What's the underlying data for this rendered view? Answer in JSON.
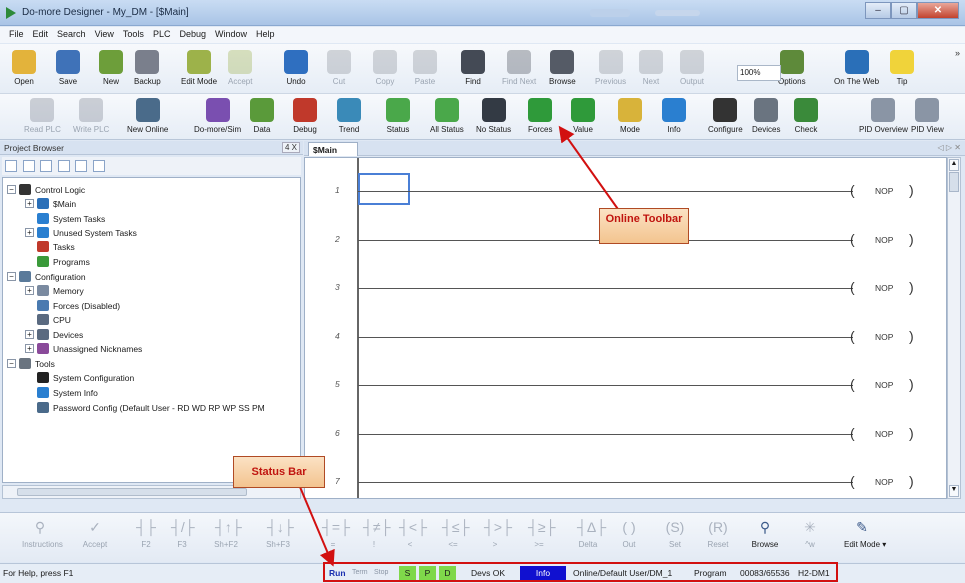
{
  "window": {
    "title": "Do-more Designer - My_DM - [$Main]",
    "buttons": [
      "–",
      "▢",
      "✕"
    ]
  },
  "menu": [
    "File",
    "Edit",
    "Search",
    "View",
    "Tools",
    "PLC",
    "Debug",
    "Window",
    "Help"
  ],
  "toolbar1": [
    {
      "label": "Open",
      "icon": "folder-open-icon",
      "color": "#e3b33b",
      "enabled": true
    },
    {
      "label": "Save",
      "icon": "save-icon",
      "color": "#3f72b8",
      "enabled": true
    },
    {
      "label": "New",
      "icon": "new-icon",
      "color": "#6d9e3a",
      "enabled": true
    },
    {
      "label": "Backup",
      "icon": "backup-icon",
      "color": "#7a7f8c",
      "enabled": true
    },
    {
      "label": "Edit Mode",
      "icon": "edit-mode-icon",
      "color": "#9db24a",
      "enabled": true
    },
    {
      "label": "Accept",
      "icon": "accept-icon",
      "color": "#9ab04a",
      "enabled": false
    },
    {
      "label": "Undo",
      "icon": "undo-icon",
      "color": "#2f6fc0",
      "enabled": true
    },
    {
      "label": "Cut",
      "icon": "cut-icon",
      "color": "#8a8f99",
      "enabled": false
    },
    {
      "label": "Copy",
      "icon": "copy-icon",
      "color": "#8a8f99",
      "enabled": false
    },
    {
      "label": "Paste",
      "icon": "paste-icon",
      "color": "#8a8f99",
      "enabled": false
    },
    {
      "label": "Find",
      "icon": "binoculars-icon",
      "color": "#444a55",
      "enabled": true
    },
    {
      "label": "Find Next",
      "icon": "find-next-icon",
      "color": "#444a55",
      "enabled": false
    },
    {
      "label": "Browse",
      "icon": "browse-icon",
      "color": "#555b66",
      "enabled": true
    },
    {
      "label": "Previous",
      "icon": "previous-icon",
      "color": "#8a8f99",
      "enabled": false
    },
    {
      "label": "Next",
      "icon": "next-icon",
      "color": "#8a8f99",
      "enabled": false
    },
    {
      "label": "Output",
      "icon": "output-icon",
      "color": "#8a8f99",
      "enabled": false
    },
    {
      "label": "Options",
      "icon": "options-icon",
      "color": "#5e8a3a",
      "enabled": true
    },
    {
      "label": "On The Web",
      "icon": "globe-icon",
      "color": "#2a6fb8",
      "enabled": true
    },
    {
      "label": "Tip",
      "icon": "lightbulb-icon",
      "color": "#f0d33a",
      "enabled": true
    }
  ],
  "zoom_value": "100%",
  "toolbar2": [
    {
      "label": "Read PLC",
      "icon": "read-plc-icon",
      "color": "#7a8290",
      "enabled": false
    },
    {
      "label": "Write PLC",
      "icon": "write-plc-icon",
      "color": "#7a8290",
      "enabled": false
    },
    {
      "label": "New Online",
      "icon": "new-online-icon",
      "color": "#4a6b8a",
      "enabled": true
    },
    {
      "label": "Do-more/Sim",
      "icon": "sim-icon",
      "color": "#7a4fb0",
      "enabled": true
    },
    {
      "label": "Data",
      "icon": "data-icon",
      "color": "#5a9a3a",
      "enabled": true
    },
    {
      "label": "Debug",
      "icon": "debug-icon",
      "color": "#c0392b",
      "enabled": true
    },
    {
      "label": "Trend",
      "icon": "trend-icon",
      "color": "#3a8ab8",
      "enabled": true
    },
    {
      "label": "Status",
      "icon": "status-icon",
      "color": "#4aa84a",
      "enabled": true
    },
    {
      "label": "All Status",
      "icon": "all-status-icon",
      "color": "#4aa84a",
      "enabled": true
    },
    {
      "label": "No Status",
      "icon": "no-status-icon",
      "color": "#333a44",
      "enabled": true
    },
    {
      "label": "Forces",
      "icon": "forces-icon",
      "color": "#2f9a3a",
      "enabled": true
    },
    {
      "label": "Value",
      "icon": "value-icon",
      "color": "#2f9a3a",
      "enabled": true
    },
    {
      "label": "Mode",
      "icon": "mode-icon",
      "color": "#d8b33a",
      "enabled": true
    },
    {
      "label": "Info",
      "icon": "info-icon",
      "color": "#2a7fd0",
      "enabled": true
    },
    {
      "label": "Configure",
      "icon": "configure-icon",
      "color": "#333333",
      "enabled": true
    },
    {
      "label": "Devices",
      "icon": "devices-icon",
      "color": "#6a7480",
      "enabled": true
    },
    {
      "label": "Check",
      "icon": "check-icon",
      "color": "#3a8a3a",
      "enabled": true
    },
    {
      "label": "PID Overview",
      "icon": "pid-overview-icon",
      "color": "#8a95a5",
      "enabled": true
    },
    {
      "label": "PID View",
      "icon": "pid-view-icon",
      "color": "#8a95a5",
      "enabled": true
    }
  ],
  "project_browser": {
    "title": "Project Browser",
    "pin": "4 X",
    "items": [
      {
        "label": "Control Logic",
        "depth": 0,
        "box": "−",
        "icon": "control-logic-icon",
        "color": "#333333"
      },
      {
        "label": "$Main",
        "depth": 1,
        "box": "+",
        "icon": "main-program-icon",
        "color": "#2a6fb8"
      },
      {
        "label": "System Tasks",
        "depth": 1,
        "box": "",
        "icon": "system-tasks-icon",
        "color": "#2a7fd0"
      },
      {
        "label": "Unused System Tasks",
        "depth": 1,
        "box": "+",
        "icon": "unused-tasks-icon",
        "color": "#2a7fd0"
      },
      {
        "label": "Tasks",
        "depth": 1,
        "box": "",
        "icon": "tasks-icon",
        "color": "#c0392b"
      },
      {
        "label": "Programs",
        "depth": 1,
        "box": "",
        "icon": "programs-icon",
        "color": "#3a9a3a"
      },
      {
        "label": "Configuration",
        "depth": 0,
        "box": "−",
        "icon": "configuration-icon",
        "color": "#5a7a9a"
      },
      {
        "label": "Memory",
        "depth": 1,
        "box": "+",
        "icon": "memory-icon",
        "color": "#7a8aa0"
      },
      {
        "label": "Forces (Disabled)",
        "depth": 1,
        "box": "",
        "icon": "forces-disabled-icon",
        "color": "#4a7ab0"
      },
      {
        "label": "CPU",
        "depth": 1,
        "box": "",
        "icon": "cpu-icon",
        "color": "#5a6a80"
      },
      {
        "label": "Devices",
        "depth": 1,
        "box": "+",
        "icon": "devices-tree-icon",
        "color": "#5a6a80"
      },
      {
        "label": "Unassigned Nicknames",
        "depth": 1,
        "box": "+",
        "icon": "nicknames-icon",
        "color": "#8a4a9a"
      },
      {
        "label": "Tools",
        "depth": 0,
        "box": "−",
        "icon": "tools-icon",
        "color": "#6a7480"
      },
      {
        "label": "System Configuration",
        "depth": 1,
        "box": "",
        "icon": "system-config-icon",
        "color": "#222222"
      },
      {
        "label": "System Info",
        "depth": 1,
        "box": "",
        "icon": "system-info-icon",
        "color": "#2a7fd0"
      },
      {
        "label": "Password Config (Default User - RD WD RP WP SS PM",
        "depth": 1,
        "box": "",
        "icon": "password-config-icon",
        "color": "#4a6a8a"
      }
    ]
  },
  "editor": {
    "tab": "$Main",
    "tab_nav": "◁ ▷ ✕",
    "rungs": [
      {
        "num": "1",
        "instruction": "NOP"
      },
      {
        "num": "2",
        "instruction": "NOP"
      },
      {
        "num": "3",
        "instruction": "NOP"
      },
      {
        "num": "4",
        "instruction": "NOP"
      },
      {
        "num": "5",
        "instruction": "NOP"
      },
      {
        "num": "6",
        "instruction": "NOP"
      },
      {
        "num": "7",
        "instruction": "NOP"
      }
    ]
  },
  "instruction_bar": [
    {
      "label": "Instructions",
      "glyph": "⚲",
      "enabled": false
    },
    {
      "label": "Accept",
      "glyph": "✓",
      "enabled": false
    },
    {
      "label": "F2",
      "glyph": "┤├",
      "enabled": false
    },
    {
      "label": "F3",
      "glyph": "┤/├",
      "enabled": false
    },
    {
      "label": "Sh+F2",
      "glyph": "┤↑├",
      "enabled": false
    },
    {
      "label": "Sh+F3",
      "glyph": "┤↓├",
      "enabled": false
    },
    {
      "label": "=",
      "glyph": "┤=├",
      "enabled": false
    },
    {
      "label": "!",
      "glyph": "┤≠├",
      "enabled": false
    },
    {
      "label": "<",
      "glyph": "┤<├",
      "enabled": false
    },
    {
      "label": "<=",
      "glyph": "┤≤├",
      "enabled": false
    },
    {
      "label": ">",
      "glyph": "┤>├",
      "enabled": false
    },
    {
      "label": ">=",
      "glyph": "┤≥├",
      "enabled": false
    },
    {
      "label": "Delta",
      "glyph": "┤Δ├",
      "enabled": false
    },
    {
      "label": "Out",
      "glyph": "( )",
      "enabled": false
    },
    {
      "label": "Set",
      "glyph": "(S)",
      "enabled": false
    },
    {
      "label": "Reset",
      "glyph": "(R)",
      "enabled": false
    },
    {
      "label": "Browse",
      "glyph": "⚲",
      "enabled": true
    },
    {
      "label": "^w",
      "glyph": "✳",
      "enabled": false
    },
    {
      "label": "Edit Mode ▾",
      "glyph": "✎",
      "enabled": true
    }
  ],
  "statusbar": {
    "help": "For Help, press F1",
    "run": "Run",
    "term": "Term",
    "stop": "Stop",
    "s": "S",
    "p": "P",
    "d": "D",
    "devs": "Devs OK",
    "info": "Info",
    "online": "Online/Default User/DM_1",
    "mode": "Program",
    "memory": "00083/65536",
    "plc": "H2-DM1"
  },
  "annotations": {
    "online_toolbar": "Online Toolbar",
    "status_bar": "Status Bar"
  },
  "colors": {
    "annotation_red": "#d21010",
    "status_green": "#7fd84a",
    "status_blue": "#1010d0",
    "run_blue": "#1a2fb0"
  }
}
